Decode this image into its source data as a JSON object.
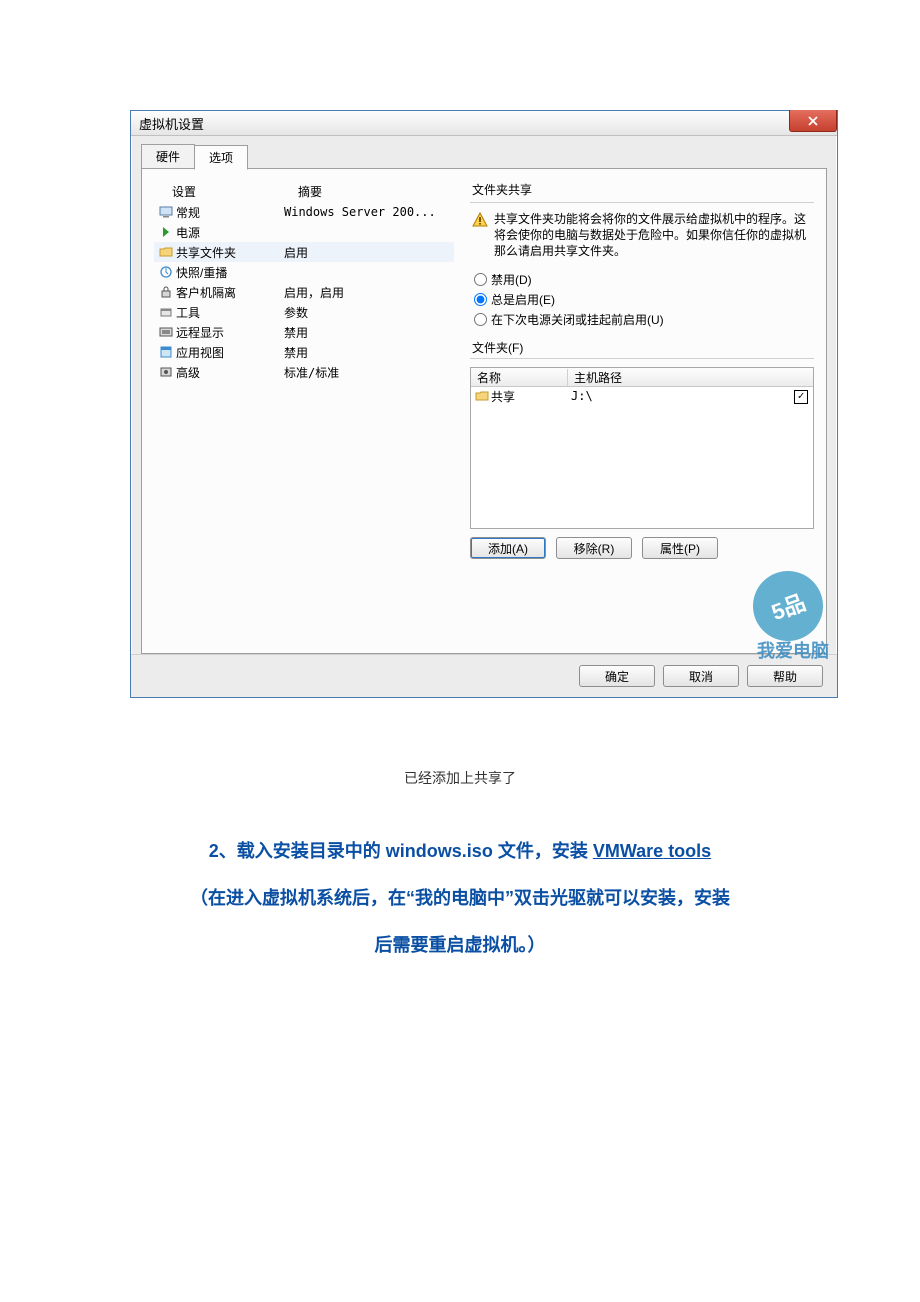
{
  "dialog": {
    "title": "虚拟机设置",
    "tabs": {
      "hardware": "硬件",
      "options": "选项"
    },
    "headers": {
      "setting": "设置",
      "summary": "摘要"
    },
    "rows": [
      {
        "icon": "monitor",
        "label": "常规",
        "summary": "Windows Server 200..."
      },
      {
        "icon": "power",
        "label": "电源",
        "summary": ""
      },
      {
        "icon": "folder",
        "label": "共享文件夹",
        "summary": "启用",
        "selected": true
      },
      {
        "icon": "snapshot",
        "label": "快照/重播",
        "summary": ""
      },
      {
        "icon": "lock",
        "label": "客户机隔离",
        "summary": "启用，启用"
      },
      {
        "icon": "tools",
        "label": "工具",
        "summary": "参数"
      },
      {
        "icon": "remote",
        "label": "远程显示",
        "summary": "禁用"
      },
      {
        "icon": "appview",
        "label": "应用视图",
        "summary": "禁用"
      },
      {
        "icon": "advanced",
        "label": "高级",
        "summary": "标准/标准"
      }
    ]
  },
  "right": {
    "group_title": "文件夹共享",
    "warning": "共享文件夹功能将会将你的文件展示给虚拟机中的程序。这将会使你的电脑与数据处于危险中。如果你信任你的虚拟机那么请启用共享文件夹。",
    "radios": {
      "disable": "禁用(D)",
      "always": "总是启用(E)",
      "until": "在下次电源关闭或挂起前启用(U)"
    },
    "folders_label": "文件夹(F)",
    "table": {
      "col_name": "名称",
      "col_path": "主机路径",
      "row": {
        "name": "共享",
        "path": "J:\\"
      }
    },
    "buttons": {
      "add": "添加(A)",
      "remove": "移除(R)",
      "props": "属性(P)"
    }
  },
  "footer": {
    "ok": "确定",
    "cancel": "取消",
    "help": "帮助"
  },
  "watermark": "我爱电脑",
  "caption": "已经添加上共享了",
  "instr": {
    "line1_prefix": "2、载入安装目录中的 windows.iso 文件，安装 ",
    "line1_link1": "VMWare",
    "line1_link2": " tools",
    "line2": "（在进入虚拟机系统后，在“我的电脑中”双击光驱就可以安装，安装",
    "line3": "后需要重启虚拟机。）"
  }
}
